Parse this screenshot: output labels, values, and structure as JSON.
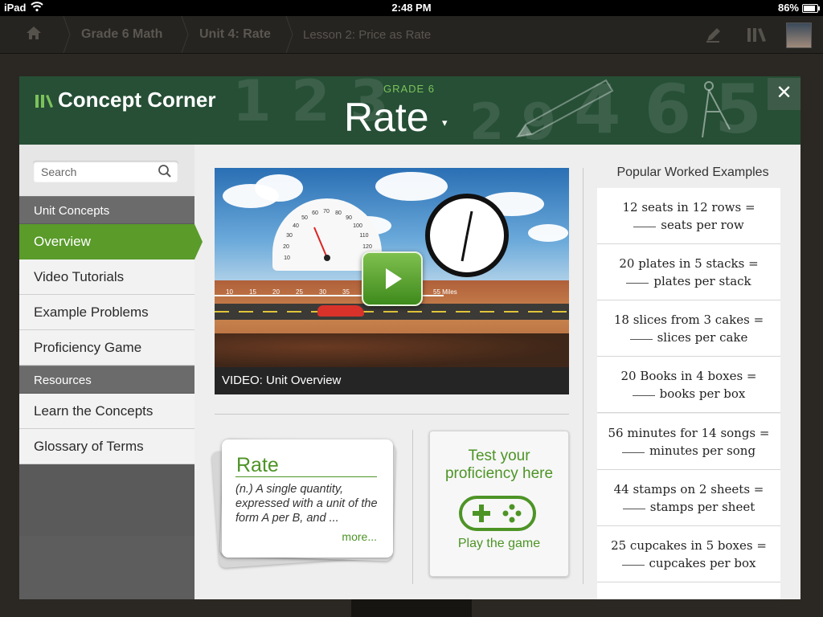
{
  "status_bar": {
    "carrier": "iPad",
    "time": "2:48 PM",
    "battery": "86%",
    "battery_level": 0.86
  },
  "top_nav": {
    "crumbs": [
      "Grade 6 Math",
      "Unit 4: Rate",
      "Lesson 2: Price as Rate"
    ]
  },
  "header": {
    "brand": "Concept Corner",
    "grade": "GRADE 6",
    "title": "Rate",
    "caret": "▾",
    "close": "✕"
  },
  "sidebar": {
    "search_placeholder": "Search",
    "sections": [
      {
        "label": "Unit Concepts",
        "items": [
          "Overview",
          "Video Tutorials",
          "Example Problems",
          "Proficiency Game"
        ]
      },
      {
        "label": "Resources",
        "items": [
          "Learn the Concepts",
          "Glossary of Terms"
        ]
      }
    ],
    "selected": "Overview"
  },
  "video": {
    "caption": "VIDEO: Unit Overview",
    "speedometer": [
      "10",
      "20",
      "30",
      "40",
      "50",
      "60",
      "70",
      "80",
      "90",
      "100",
      "110",
      "120"
    ],
    "ruler_ticks": [
      "10",
      "15",
      "20",
      "25",
      "30",
      "35"
    ],
    "ruler_end": "55 Miles"
  },
  "glossary_card": {
    "term": "Rate",
    "definition": "(n.) A single quantity, expressed with a unit of the form A per B, and ...",
    "more": "more..."
  },
  "game_card": {
    "headline": "Test your proficiency here",
    "action": "Play the game"
  },
  "examples": {
    "title": "Popular Worked Examples",
    "items": [
      {
        "line1": "12 seats in 12 rows =",
        "line2": "seats per row"
      },
      {
        "line1": "20 plates in 5 stacks =",
        "line2": "plates per stack"
      },
      {
        "line1": "18 slices from 3 cakes =",
        "line2": "slices per cake"
      },
      {
        "line1": "20 Books in 4 boxes =",
        "line2": "books per box"
      },
      {
        "line1": "56 minutes for 14 songs =",
        "line2": "minutes per song"
      },
      {
        "line1": "44 stamps on 2 sheets =",
        "line2": "stamps per sheet"
      },
      {
        "line1": "25 cupcakes in 5 boxes =",
        "line2": "cupcakes per box"
      }
    ]
  },
  "colors": {
    "accent": "#5a9b2a",
    "header": "#264f36",
    "text_green": "#4d9426"
  }
}
